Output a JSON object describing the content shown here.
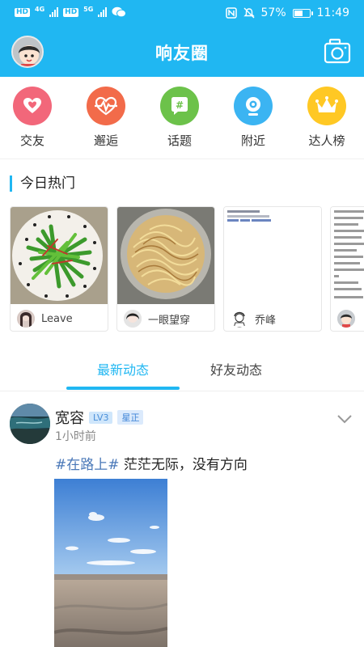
{
  "statusbar": {
    "net_tag_1": "HD",
    "net_1": "4G",
    "net_tag_2": "HD",
    "net_2": "5G",
    "battery": "57%",
    "battery_level": 0.57,
    "time": "11:49"
  },
  "header": {
    "title": "响友圈"
  },
  "categories": [
    {
      "label": "交友",
      "icon": "heart-icon",
      "color": "#f2677a"
    },
    {
      "label": "邂逅",
      "icon": "heartbeat-icon",
      "color": "#f26b4a"
    },
    {
      "label": "话题",
      "icon": "hashtag-icon",
      "color": "#6cc24a"
    },
    {
      "label": "附近",
      "icon": "webcam-icon",
      "color": "#3bb4f2"
    },
    {
      "label": "达人榜",
      "icon": "crown-icon",
      "color": "#ffc824"
    }
  ],
  "hot": {
    "title": "今日热门",
    "cards": [
      {
        "name": "Leave"
      },
      {
        "name": "一眼望穿"
      },
      {
        "name": "乔峰"
      },
      {
        "name": ""
      }
    ]
  },
  "tabs": {
    "active": "最新动态",
    "inactive": "好友动态"
  },
  "post": {
    "username": "宽容",
    "level": "LV3",
    "verified": "星正",
    "time": "1小时前",
    "hashtag": "#在路上#",
    "text": " 茫茫无际，没有方向"
  },
  "colors": {
    "accent": "#20b7f2"
  }
}
